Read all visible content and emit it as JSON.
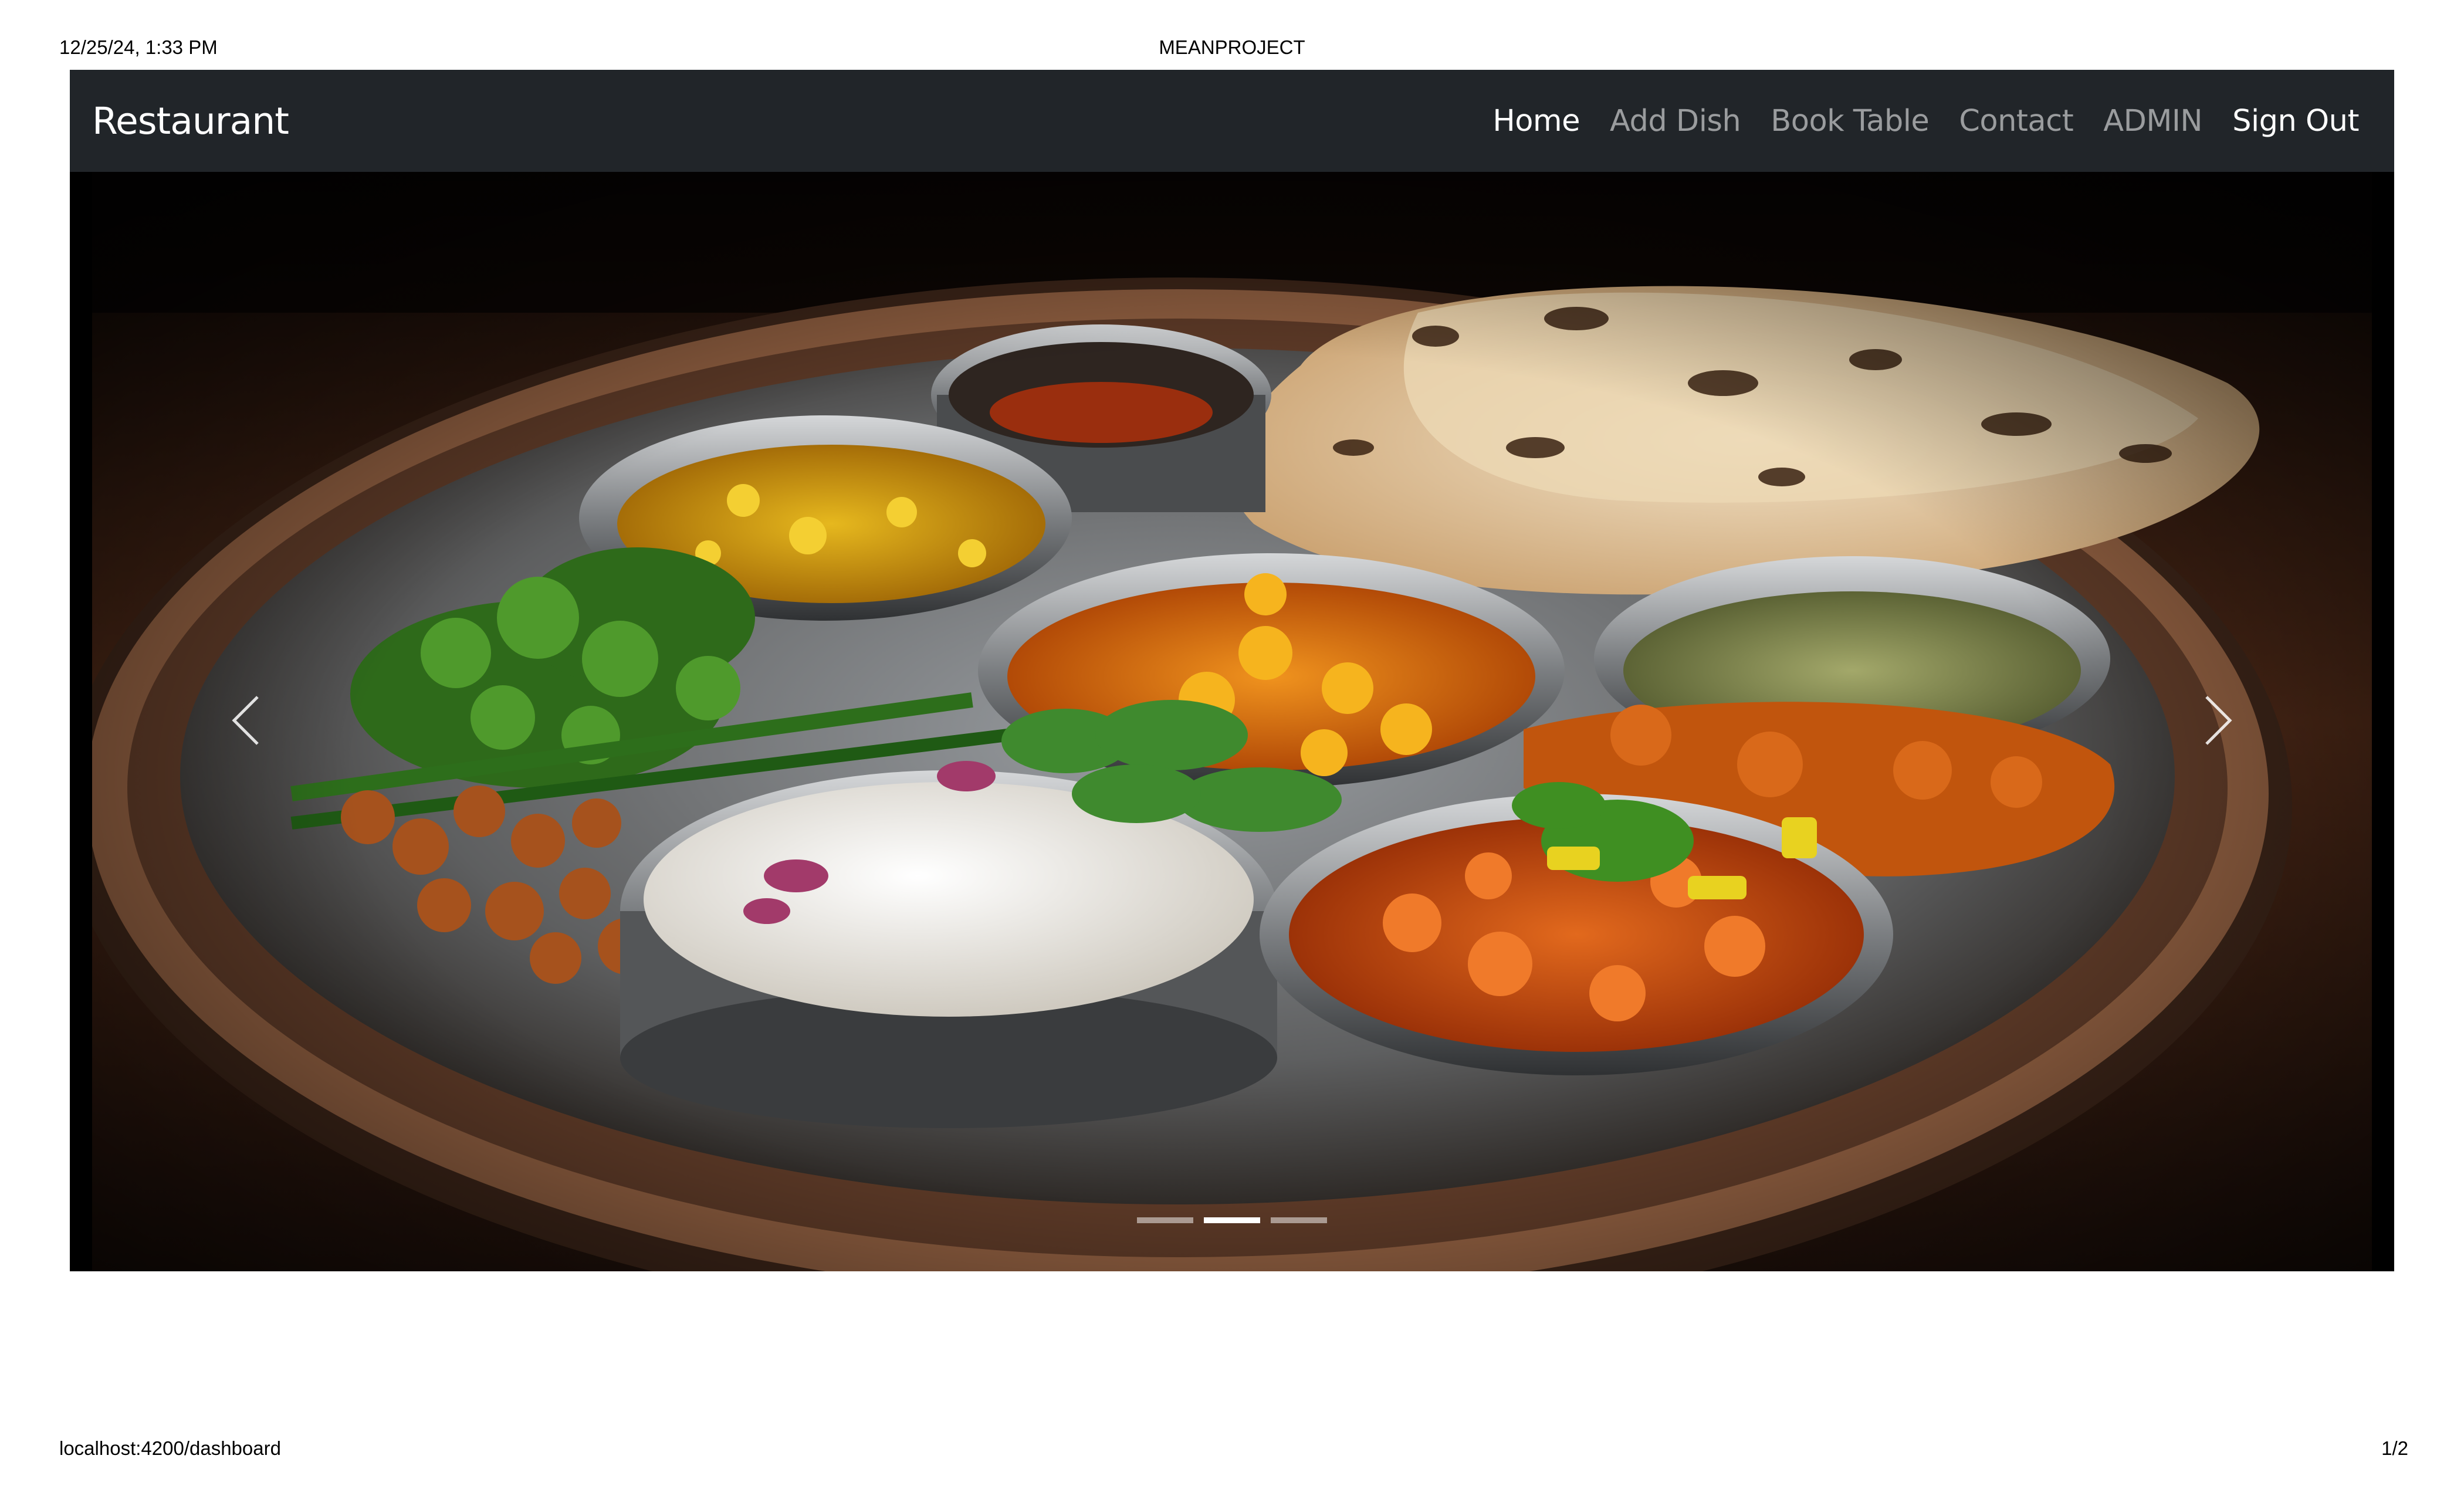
{
  "print_header": {
    "date": "12/25/24, 1:33 PM",
    "title": "MEANPROJECT"
  },
  "print_footer": {
    "url": "localhost:4200/dashboard",
    "pages": "1/2"
  },
  "navbar": {
    "brand": "Restaurant",
    "links": [
      {
        "label": "Home",
        "active": true
      },
      {
        "label": "Add Dish"
      },
      {
        "label": "Book Table"
      },
      {
        "label": "Contact"
      },
      {
        "label": "ADMIN"
      },
      {
        "label": "Sign Out"
      }
    ]
  },
  "carousel": {
    "slide_count": 3,
    "active_index": 1,
    "prev_icon": "chevron-left-icon",
    "next_icon": "chevron-right-icon"
  },
  "colors": {
    "navbar_bg": "#212529",
    "nav_active": "#ffffff",
    "nav_inactive": "#8e9196"
  }
}
